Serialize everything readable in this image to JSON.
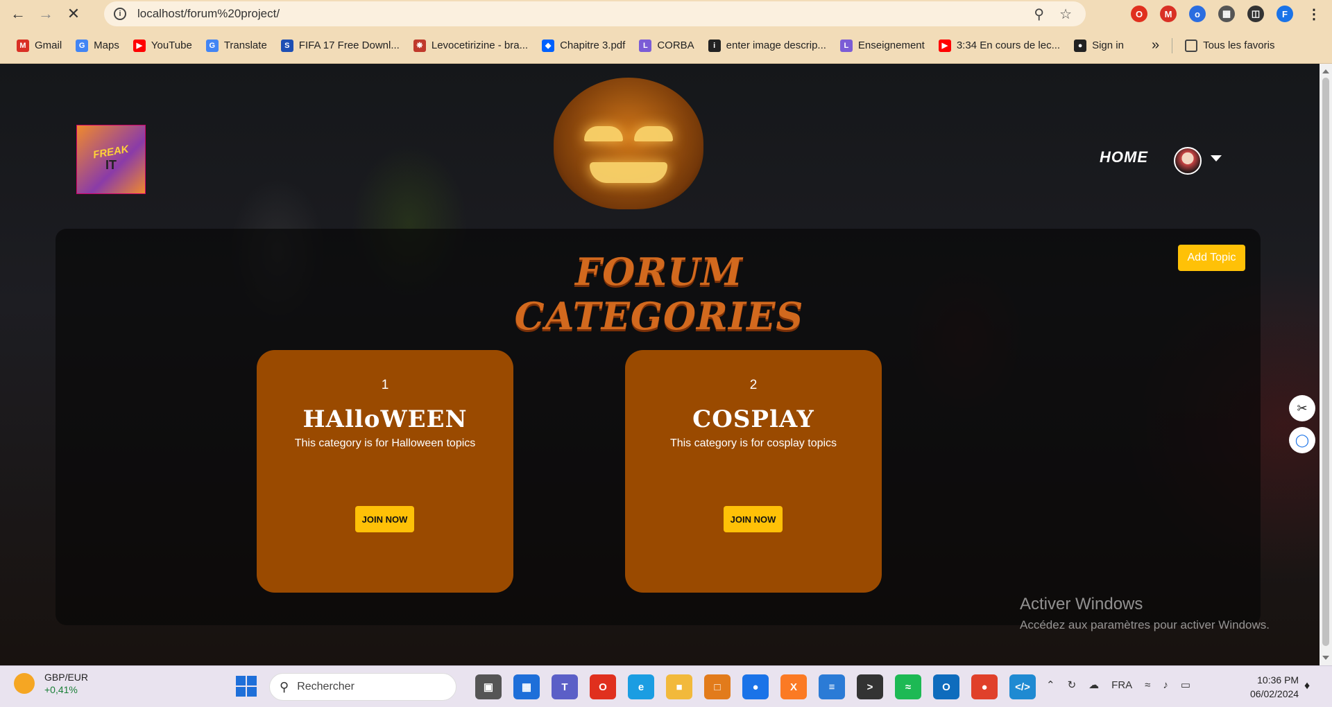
{
  "browser": {
    "url": "localhost/forum%20project/",
    "profile_initial": "F",
    "bookmarks": [
      {
        "label": "Gmail",
        "icon": "gmail-icon",
        "color": "#d93025"
      },
      {
        "label": "Maps",
        "icon": "google-icon",
        "color": "#4285f4"
      },
      {
        "label": "YouTube",
        "icon": "youtube-icon",
        "color": "#ff0000"
      },
      {
        "label": "Translate",
        "icon": "translate-icon",
        "color": "#4285f4"
      },
      {
        "label": "FIFA 17 Free Downl...",
        "icon": "s-icon",
        "color": "#1e4fb4"
      },
      {
        "label": "Levocetirizine - bra...",
        "icon": "molecule-icon",
        "color": "#c0392b"
      },
      {
        "label": "Chapitre 3.pdf",
        "icon": "dropbox-icon",
        "color": "#0061fe"
      },
      {
        "label": "CORBA",
        "icon": "l-icon",
        "color": "#7b5cd6"
      },
      {
        "label": "enter image descrip...",
        "icon": "info-icon",
        "color": "#222"
      },
      {
        "label": "Enseignement",
        "icon": "l-icon",
        "color": "#7b5cd6"
      },
      {
        "label": "3:34 En cours de lec...",
        "icon": "youtube-icon",
        "color": "#ff0000"
      },
      {
        "label": "Sign in",
        "icon": "github-icon",
        "color": "#222"
      }
    ],
    "more_label": "»",
    "all_favorites": "Tous les favoris"
  },
  "site": {
    "logo_text_1": "FREAK",
    "logo_text_2": "IT",
    "nav_home": "HOME",
    "add_topic": "Add Topic",
    "heading": "FORUM CATEGORIES",
    "categories": [
      {
        "number": "1",
        "name": "HAlloWEEN",
        "description": "This category is for Halloween topics",
        "button": "JOIN NOW"
      },
      {
        "number": "2",
        "name": "COSPlAY",
        "description": "This category is for cosplay topics",
        "button": "JOIN NOW"
      }
    ]
  },
  "windows_activation": {
    "title": "Activer Windows",
    "subtitle": "Accédez aux paramètres pour activer Windows."
  },
  "taskbar": {
    "ticker_name": "GBP/EUR",
    "ticker_change": "+0,41%",
    "search_placeholder": "Rechercher",
    "language": "FRA",
    "time": "10:36 PM",
    "date": "06/02/2024"
  },
  "colors": {
    "accent_yellow": "#ffc107",
    "card_orange": "#9a4a00",
    "heading_orange": "#d2691e"
  }
}
